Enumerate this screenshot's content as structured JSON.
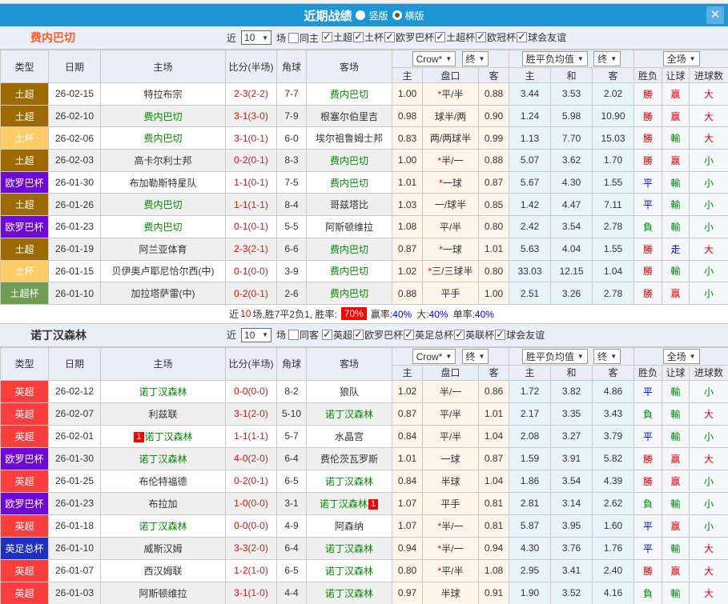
{
  "title_bar": {
    "title": "近期战绩",
    "vertical_label": "竖版",
    "horizontal_label": "横版",
    "close_glyph": "✕"
  },
  "colors": {
    "titlebar_blue": "#1e96d5",
    "accent_red": "#ff0000",
    "self_team_green": "#008800",
    "result_blue": "#0000dd"
  },
  "league_colors": {
    "土超": "#9c6a00",
    "土杯": "#ffcc66",
    "欧罗巴杯": "#6e0ad8",
    "土超杯": "#6e9c55",
    "英超": "#fb3d3d",
    "英足总杯": "#1e2fc8"
  },
  "table_header": {
    "type": "类型",
    "date": "日期",
    "home": "主场",
    "score": "比分(半场)",
    "corner": "角球",
    "away": "客场",
    "sel_crown": "Crow*",
    "sel_final": "终",
    "sel_avg": "胜平负均值",
    "sel_scope": "全场",
    "sub": [
      "主",
      "盘口",
      "客",
      "主",
      "和",
      "客",
      "胜负",
      "让球",
      "进球数"
    ]
  },
  "sections": [
    {
      "team": "费内巴切",
      "filter": {
        "near_label": "近",
        "count": "10",
        "matches_label": "场",
        "same_label": "同主",
        "leagues": [
          "土超",
          "土杯",
          "欧罗巴杯",
          "土超杯",
          "欧冠杯",
          "球会友谊"
        ]
      },
      "rows": [
        {
          "league": "土超",
          "date": "26-02-15",
          "home": "特拉布宗",
          "home_self": false,
          "score": "2-3",
          "half": "(2-2)",
          "corners": "7-7",
          "away": "费内巴切",
          "away_self": true,
          "o1": "1.00",
          "hcap": "*平/半",
          "o2": "0.88",
          "w": "3.44",
          "d": "3.53",
          "l": "2.02",
          "res": "勝",
          "res_c": "r",
          "let": "赢",
          "let_c": "r",
          "big": "大",
          "big_c": "r"
        },
        {
          "league": "土超",
          "date": "26-02-10",
          "home": "费内巴切",
          "home_self": true,
          "score": "3-1",
          "half": "(3-0)",
          "corners": "7-9",
          "away": "根塞尔伯里吉",
          "away_self": false,
          "o1": "0.98",
          "hcap": "球半/两",
          "o2": "0.90",
          "w": "1.24",
          "d": "5.98",
          "l": "10.90",
          "res": "勝",
          "res_c": "r",
          "let": "赢",
          "let_c": "r",
          "big": "大",
          "big_c": "r"
        },
        {
          "league": "土杯",
          "date": "26-02-06",
          "home": "费内巴切",
          "home_self": true,
          "score": "3-1",
          "half": "(0-1)",
          "corners": "6-0",
          "away": "埃尔祖鲁姆士邦",
          "away_self": false,
          "o1": "0.83",
          "hcap": "两/两球半",
          "o2": "0.99",
          "w": "1.13",
          "d": "7.70",
          "l": "15.03",
          "res": "勝",
          "res_c": "r",
          "let": "輸",
          "let_c": "g",
          "big": "大",
          "big_c": "r"
        },
        {
          "league": "土超",
          "date": "26-02-03",
          "home": "高卡尔利士邦",
          "home_self": false,
          "score": "0-2",
          "half": "(0-1)",
          "corners": "8-3",
          "away": "费内巴切",
          "away_self": true,
          "o1": "1.00",
          "hcap": "*半/一",
          "o2": "0.88",
          "w": "5.07",
          "d": "3.62",
          "l": "1.70",
          "res": "勝",
          "res_c": "r",
          "let": "赢",
          "let_c": "r",
          "big": "小",
          "big_c": "g"
        },
        {
          "league": "欧罗巴杯",
          "date": "26-01-30",
          "home": "布加勒斯特星队",
          "home_self": false,
          "score": "1-1",
          "half": "(0-1)",
          "corners": "7-5",
          "away": "费内巴切",
          "away_self": true,
          "o1": "1.01",
          "hcap": "*一球",
          "o2": "0.87",
          "w": "5.67",
          "d": "4.30",
          "l": "1.55",
          "res": "平",
          "res_c": "b",
          "let": "輸",
          "let_c": "g",
          "big": "小",
          "big_c": "g"
        },
        {
          "league": "土超",
          "date": "26-01-26",
          "home": "费内巴切",
          "home_self": true,
          "score": "1-1",
          "half": "(1-1)",
          "corners": "8-4",
          "away": "哥兹塔比",
          "away_self": false,
          "o1": "1.03",
          "hcap": "一/球半",
          "o2": "0.85",
          "w": "1.42",
          "d": "4.47",
          "l": "7.11",
          "res": "平",
          "res_c": "b",
          "let": "輸",
          "let_c": "g",
          "big": "小",
          "big_c": "g"
        },
        {
          "league": "欧罗巴杯",
          "date": "26-01-23",
          "home": "费内巴切",
          "home_self": true,
          "score": "0-1",
          "half": "(0-1)",
          "corners": "5-5",
          "away": "阿斯顿维拉",
          "away_self": false,
          "o1": "1.08",
          "hcap": "平/半",
          "o2": "0.80",
          "w": "2.42",
          "d": "3.54",
          "l": "2.78",
          "res": "負",
          "res_c": "g",
          "let": "輸",
          "let_c": "g",
          "big": "小",
          "big_c": "g"
        },
        {
          "league": "土超",
          "date": "26-01-19",
          "home": "阿兰亚体育",
          "home_self": false,
          "score": "2-3",
          "half": "(2-1)",
          "corners": "6-6",
          "away": "费内巴切",
          "away_self": true,
          "o1": "0.87",
          "hcap": "*一球",
          "o2": "1.01",
          "w": "5.63",
          "d": "4.04",
          "l": "1.55",
          "res": "勝",
          "res_c": "r",
          "let": "走",
          "let_c": "b",
          "big": "大",
          "big_c": "r"
        },
        {
          "league": "土杯",
          "date": "26-01-15",
          "home": "贝伊奥卢耶尼恰尔西(中)",
          "home_self": false,
          "score": "0-1",
          "half": "(0-0)",
          "corners": "3-9",
          "away": "费内巴切",
          "away_self": true,
          "o1": "1.02",
          "hcap": "*三/三球半",
          "o2": "0.80",
          "w": "33.03",
          "d": "12.15",
          "l": "1.04",
          "res": "勝",
          "res_c": "r",
          "let": "輸",
          "let_c": "g",
          "big": "小",
          "big_c": "g"
        },
        {
          "league": "土超杯",
          "date": "26-01-10",
          "home": "加拉塔萨雷(中)",
          "home_self": false,
          "score": "0-2",
          "half": "(0-1)",
          "corners": "2-6",
          "away": "费内巴切",
          "away_self": true,
          "o1": "0.88",
          "hcap": "平手",
          "o2": "1.00",
          "w": "2.51",
          "d": "3.26",
          "l": "2.78",
          "res": "勝",
          "res_c": "r",
          "let": "赢",
          "let_c": "r",
          "big": "小",
          "big_c": "g"
        }
      ],
      "summary": {
        "prefix": "近",
        "count": "10",
        "mid": "场,胜7平2负1, 胜率:",
        "win_rate": "70%",
        "parts": [
          {
            "label": "赢率:",
            "value": "40%"
          },
          {
            "label": "大:",
            "value": "40%"
          },
          {
            "label": "单率:",
            "value": "40%"
          }
        ]
      }
    },
    {
      "team": "诺丁汉森林",
      "filter": {
        "near_label": "近",
        "count": "10",
        "matches_label": "场",
        "same_label": "同客",
        "leagues": [
          "英超",
          "欧罗巴杯",
          "英足总杯",
          "英联杯",
          "球会友谊"
        ]
      },
      "rows": [
        {
          "league": "英超",
          "date": "26-02-12",
          "home": "诺丁汉森林",
          "home_self": true,
          "score": "0-0",
          "half": "(0-0)",
          "corners": "8-2",
          "away": "狼队",
          "away_self": false,
          "o1": "1.02",
          "hcap": "半/一",
          "o2": "0.86",
          "w": "1.72",
          "d": "3.82",
          "l": "4.86",
          "res": "平",
          "res_c": "b",
          "let": "輸",
          "let_c": "g",
          "big": "小",
          "big_c": "g"
        },
        {
          "league": "英超",
          "date": "26-02-07",
          "home": "利兹联",
          "home_self": false,
          "score": "3-1",
          "half": "(2-0)",
          "corners": "5-10",
          "away": "诺丁汉森林",
          "away_self": true,
          "o1": "0.87",
          "hcap": "平/半",
          "o2": "1.01",
          "w": "2.17",
          "d": "3.35",
          "l": "3.43",
          "res": "負",
          "res_c": "g",
          "let": "輸",
          "let_c": "g",
          "big": "大",
          "big_c": "r"
        },
        {
          "league": "英超",
          "date": "26-02-01",
          "home": "诺丁汉森林",
          "home_self": true,
          "home_badge": "1",
          "score": "1-1",
          "half": "(1-1)",
          "corners": "5-7",
          "away": "水晶宫",
          "away_self": false,
          "o1": "0.84",
          "hcap": "平/半",
          "o2": "1.04",
          "w": "2.08",
          "d": "3.27",
          "l": "3.79",
          "res": "平",
          "res_c": "b",
          "let": "輸",
          "let_c": "g",
          "big": "小",
          "big_c": "g"
        },
        {
          "league": "欧罗巴杯",
          "date": "26-01-30",
          "home": "诺丁汉森林",
          "home_self": true,
          "score": "4-0",
          "half": "(2-0)",
          "corners": "6-4",
          "away": "费伦茨瓦罗斯",
          "away_self": false,
          "o1": "1.01",
          "hcap": "一球",
          "o2": "0.87",
          "w": "1.59",
          "d": "3.91",
          "l": "5.82",
          "res": "勝",
          "res_c": "r",
          "let": "赢",
          "let_c": "r",
          "big": "大",
          "big_c": "r"
        },
        {
          "league": "英超",
          "date": "26-01-25",
          "home": "布伦特福德",
          "home_self": false,
          "score": "0-2",
          "half": "(0-1)",
          "corners": "6-5",
          "away": "诺丁汉森林",
          "away_self": true,
          "o1": "0.84",
          "hcap": "半球",
          "o2": "1.04",
          "w": "1.86",
          "d": "3.54",
          "l": "4.39",
          "res": "勝",
          "res_c": "r",
          "let": "赢",
          "let_c": "r",
          "big": "小",
          "big_c": "g"
        },
        {
          "league": "欧罗巴杯",
          "date": "26-01-23",
          "home": "布拉加",
          "home_self": false,
          "score": "1-0",
          "half": "(0-0)",
          "corners": "3-1",
          "away": "诺丁汉森林",
          "away_self": true,
          "away_badge": "1",
          "o1": "1.07",
          "hcap": "平手",
          "o2": "0.81",
          "w": "2.81",
          "d": "3.14",
          "l": "2.62",
          "res": "負",
          "res_c": "g",
          "let": "輸",
          "let_c": "g",
          "big": "小",
          "big_c": "g"
        },
        {
          "league": "英超",
          "date": "26-01-18",
          "home": "诺丁汉森林",
          "home_self": true,
          "score": "0-0",
          "half": "(0-0)",
          "corners": "4-9",
          "away": "阿森纳",
          "away_self": false,
          "o1": "1.07",
          "hcap": "*半/一",
          "o2": "0.81",
          "w": "5.87",
          "d": "3.95",
          "l": "1.60",
          "res": "平",
          "res_c": "b",
          "let": "赢",
          "let_c": "r",
          "big": "小",
          "big_c": "g"
        },
        {
          "league": "英足总杯",
          "date": "26-01-10",
          "home": "威斯汉姆",
          "home_self": false,
          "score": "3-3",
          "half": "(2-0)",
          "corners": "6-4",
          "away": "诺丁汉森林",
          "away_self": true,
          "o1": "0.94",
          "hcap": "*半/一",
          "o2": "0.94",
          "w": "4.30",
          "d": "3.76",
          "l": "1.76",
          "res": "平",
          "res_c": "b",
          "let": "輸",
          "let_c": "g",
          "big": "大",
          "big_c": "r"
        },
        {
          "league": "英超",
          "date": "26-01-07",
          "home": "西汉姆联",
          "home_self": false,
          "score": "1-2",
          "half": "(1-0)",
          "corners": "6-5",
          "away": "诺丁汉森林",
          "away_self": true,
          "o1": "0.80",
          "hcap": "*平/半",
          "o2": "1.08",
          "w": "2.95",
          "d": "3.41",
          "l": "2.40",
          "res": "勝",
          "res_c": "r",
          "let": "赢",
          "let_c": "r",
          "big": "大",
          "big_c": "r"
        },
        {
          "league": "英超",
          "date": "26-01-03",
          "home": "阿斯顿维拉",
          "home_self": false,
          "score": "3-1",
          "half": "(1-0)",
          "corners": "4-4",
          "away": "诺丁汉森林",
          "away_self": true,
          "o1": "0.97",
          "hcap": "半球",
          "o2": "0.91",
          "w": "1.90",
          "d": "3.52",
          "l": "4.16",
          "res": "負",
          "res_c": "g",
          "let": "輸",
          "let_c": "g",
          "big": "大",
          "big_c": "r"
        }
      ],
      "summary": null
    }
  ]
}
